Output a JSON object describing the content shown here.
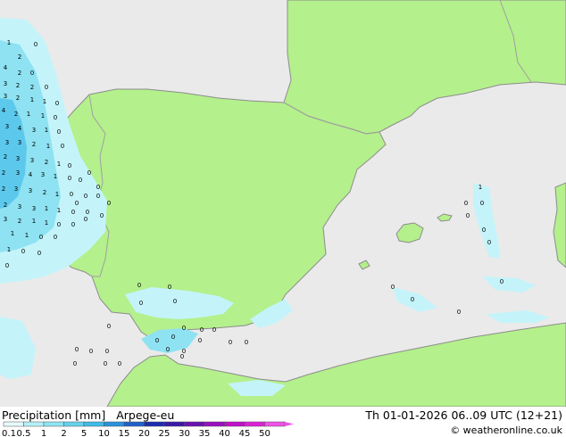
{
  "header": {
    "title": "Precipitation [mm]",
    "model": "Arpege-eu",
    "datetime": "Th 01-01-2026 06..09 UTC (12+21)"
  },
  "copyright": "© weatheronline.co.uk",
  "legend": {
    "labels": [
      "0.1",
      "0.5",
      "1",
      "2",
      "5",
      "10",
      "15",
      "20",
      "25",
      "30",
      "35",
      "40",
      "45",
      "50"
    ],
    "colors": [
      "#e6fafd",
      "#b5f0f7",
      "#8fe4f2",
      "#66d2ed",
      "#3ebbe6",
      "#2a92dc",
      "#2061c8",
      "#1c2db2",
      "#3a1aa8",
      "#6a12b0",
      "#9a0fc0",
      "#c010cc",
      "#dc20d8",
      "#f050e8"
    ]
  },
  "map_colors": {
    "sea": "#eaeaea",
    "land": "#b4f08c",
    "coast": "#8c8c8c",
    "border": "#a0a0a0",
    "precip_light": "#c4f4fa",
    "precip_mid": "#8ee2f2",
    "precip_heavy": "#5cc8ec"
  },
  "precip_labels": [
    {
      "t": "1"
    },
    {
      "t": "2"
    },
    {
      "t": "0"
    },
    {
      "t": "4"
    },
    {
      "t": "2"
    },
    {
      "t": "0"
    },
    {
      "t": "3"
    },
    {
      "t": "2"
    },
    {
      "t": "2"
    },
    {
      "t": "0"
    },
    {
      "t": "3"
    },
    {
      "t": "2"
    },
    {
      "t": "1"
    },
    {
      "t": "1"
    },
    {
      "t": "0"
    },
    {
      "t": "4"
    },
    {
      "t": "2"
    },
    {
      "t": "1"
    },
    {
      "t": "1"
    },
    {
      "t": "0"
    },
    {
      "t": "3"
    },
    {
      "t": "4"
    },
    {
      "t": "3"
    },
    {
      "t": "1"
    },
    {
      "t": "0"
    },
    {
      "t": "3"
    },
    {
      "t": "3"
    },
    {
      "t": "2"
    },
    {
      "t": "1"
    },
    {
      "t": "0"
    },
    {
      "t": "2"
    },
    {
      "t": "3"
    },
    {
      "t": "3"
    },
    {
      "t": "2"
    },
    {
      "t": "1"
    },
    {
      "t": "0"
    },
    {
      "t": "2"
    },
    {
      "t": "3"
    },
    {
      "t": "4"
    },
    {
      "t": "3"
    },
    {
      "t": "1"
    },
    {
      "t": "0"
    },
    {
      "t": "0"
    },
    {
      "t": "2"
    },
    {
      "t": "3"
    },
    {
      "t": "3"
    },
    {
      "t": "2"
    },
    {
      "t": "1"
    },
    {
      "t": "0"
    },
    {
      "t": "0"
    },
    {
      "t": "0"
    },
    {
      "t": "2"
    },
    {
      "t": "3"
    },
    {
      "t": "3"
    },
    {
      "t": "1"
    },
    {
      "t": "1"
    },
    {
      "t": "0"
    },
    {
      "t": "0"
    },
    {
      "t": "3"
    },
    {
      "t": "2"
    },
    {
      "t": "1"
    },
    {
      "t": "1"
    },
    {
      "t": "0"
    },
    {
      "t": "0"
    },
    {
      "t": "1"
    },
    {
      "t": "1"
    },
    {
      "t": "0"
    },
    {
      "t": "0"
    },
    {
      "t": "1"
    },
    {
      "t": "0"
    },
    {
      "t": "0"
    },
    {
      "t": "0"
    },
    {
      "t": "0"
    },
    {
      "t": "0"
    },
    {
      "t": "0"
    },
    {
      "t": "0"
    },
    {
      "t": "0"
    },
    {
      "t": "0"
    },
    {
      "t": "0"
    },
    {
      "t": "0"
    },
    {
      "t": "0"
    },
    {
      "t": "0"
    },
    {
      "t": "0"
    },
    {
      "t": "0"
    },
    {
      "t": "0"
    },
    {
      "t": "0"
    },
    {
      "t": "0"
    },
    {
      "t": "0"
    },
    {
      "t": "0"
    },
    {
      "t": "0"
    },
    {
      "t": "0"
    },
    {
      "t": "0"
    },
    {
      "t": "0"
    },
    {
      "t": "0"
    },
    {
      "t": "0"
    },
    {
      "t": "0"
    },
    {
      "t": "0"
    },
    {
      "t": "0"
    },
    {
      "t": "0"
    },
    {
      "t": "0"
    },
    {
      "t": "1"
    },
    {
      "t": "0"
    },
    {
      "t": "0"
    },
    {
      "t": "0"
    },
    {
      "t": "0"
    },
    {
      "t": "0"
    },
    {
      "t": "0"
    },
    {
      "t": "0"
    },
    {
      "t": "0"
    },
    {
      "t": "0"
    }
  ]
}
